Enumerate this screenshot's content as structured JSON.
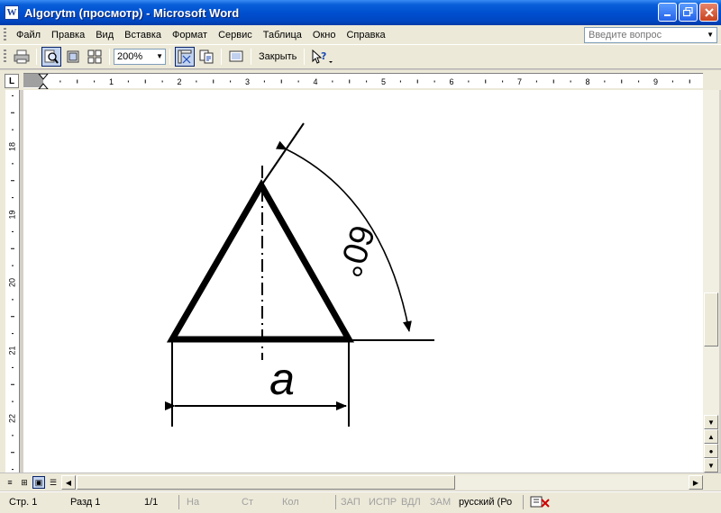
{
  "window": {
    "title": "Algorytm (просмотр) - Microsoft Word",
    "app_icon": "W",
    "buttons": [
      "minimize",
      "restore",
      "close"
    ]
  },
  "menu": {
    "items": [
      "Файл",
      "Правка",
      "Вид",
      "Вставка",
      "Формат",
      "Сервис",
      "Таблица",
      "Окно",
      "Справка"
    ],
    "ask_placeholder": "Введите вопрос"
  },
  "toolbar": {
    "zoom": "200%",
    "close_label": "Закрыть",
    "icons": [
      "print-icon",
      "magnifier-icon",
      "one-page-icon",
      "multiple-pages-icon",
      "zoom-dropdown",
      "view-ruler-icon",
      "shrink-to-fit-icon",
      "full-screen-icon",
      "close-button",
      "context-help-icon"
    ]
  },
  "ruler": {
    "tab_selector": "L",
    "h_numbers": [
      "1",
      "2",
      "3",
      "4",
      "5",
      "6",
      "7",
      "8",
      "9"
    ],
    "v_numbers": [
      "18",
      "19",
      "20",
      "21",
      "22"
    ]
  },
  "drawing": {
    "label_a": "a",
    "angle_label": "60°",
    "colors": {
      "line": "#000000",
      "paper": "#ffffff"
    }
  },
  "status": {
    "page": "Стр. 1",
    "section": "Разд 1",
    "pages": "1/1",
    "at": "На",
    "line": "Ст",
    "col": "Кол",
    "rec": "ЗАП",
    "trk": "ИСПР",
    "ext": "ВДЛ",
    "ovr": "ЗАМ",
    "language": "русский (Ро"
  },
  "colors": {
    "titlebar": "#0050d0",
    "chrome": "#ece9d8",
    "accent_pressed": "#c1d2ee"
  }
}
